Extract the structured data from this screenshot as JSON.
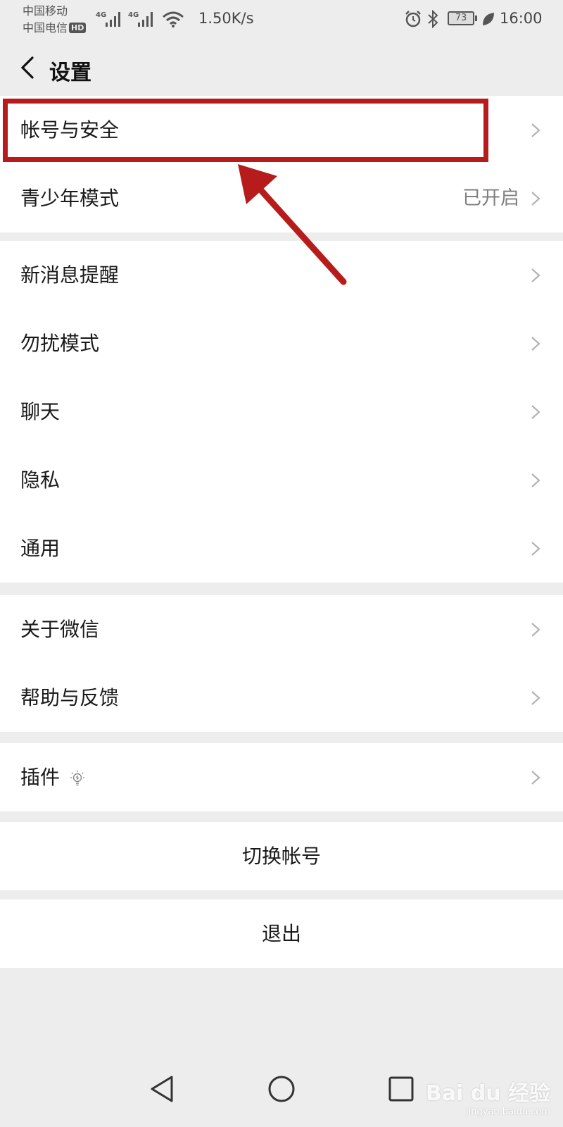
{
  "status_bar": {
    "carrier_1": "中国移动",
    "carrier_2": "中国电信",
    "hd_badge": "HD",
    "network_1": "4G",
    "network_2": "4G",
    "speed": "1.50K/s",
    "battery": "73",
    "time": "16:00"
  },
  "header": {
    "title": "设置"
  },
  "groups": [
    {
      "rows": [
        {
          "label": "帐号与安全"
        },
        {
          "label": "青少年模式",
          "value": "已开启"
        }
      ]
    },
    {
      "rows": [
        {
          "label": "新消息提醒"
        },
        {
          "label": "勿扰模式"
        },
        {
          "label": "聊天"
        },
        {
          "label": "隐私"
        },
        {
          "label": "通用"
        }
      ]
    },
    {
      "rows": [
        {
          "label": "关于微信"
        },
        {
          "label": "帮助与反馈"
        }
      ]
    },
    {
      "rows": [
        {
          "label": "插件",
          "icon": "lightbulb-icon"
        }
      ]
    }
  ],
  "actions": {
    "switch_account": "切换帐号",
    "logout": "退出"
  },
  "colors": {
    "background": "#ededed",
    "row": "#ffffff",
    "annotation": "#b71c1c"
  },
  "watermark": {
    "brand": "Bai du 经验",
    "url": "jingyan.baidu.com"
  }
}
